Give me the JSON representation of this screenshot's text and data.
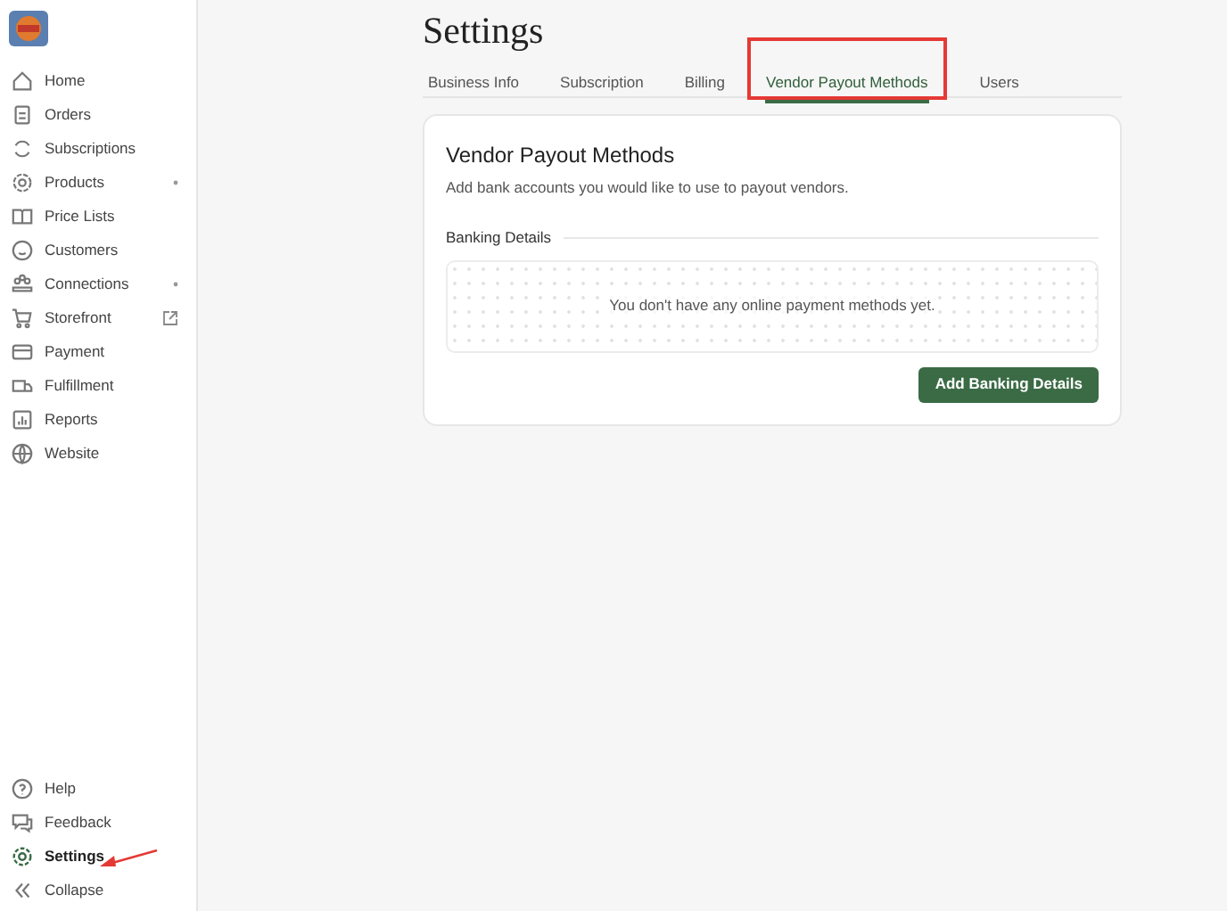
{
  "sidebar": {
    "items": [
      {
        "label": "Home",
        "kind": "plain",
        "selected": false
      },
      {
        "label": "Orders",
        "kind": "plain",
        "selected": false
      },
      {
        "label": "Subscriptions",
        "kind": "plain",
        "selected": false
      },
      {
        "label": "Products",
        "kind": "expandable",
        "selected": false
      },
      {
        "label": "Price Lists",
        "kind": "plain",
        "selected": false
      },
      {
        "label": "Customers",
        "kind": "plain",
        "selected": false
      },
      {
        "label": "Connections",
        "kind": "expandable",
        "selected": false
      },
      {
        "label": "Storefront",
        "kind": "external",
        "selected": false
      },
      {
        "label": "Payment",
        "kind": "plain",
        "selected": false
      },
      {
        "label": "Fulfillment",
        "kind": "plain",
        "selected": false
      },
      {
        "label": "Reports",
        "kind": "plain",
        "selected": false
      },
      {
        "label": "Website",
        "kind": "plain",
        "selected": false
      }
    ],
    "footer_items": [
      {
        "label": "Help",
        "selected": false
      },
      {
        "label": "Feedback",
        "selected": false
      },
      {
        "label": "Settings",
        "selected": true
      },
      {
        "label": "Collapse",
        "selected": false
      }
    ]
  },
  "page": {
    "title": "Settings",
    "tabs": [
      {
        "label": "Business Info",
        "selected": false
      },
      {
        "label": "Subscription",
        "selected": false
      },
      {
        "label": "Billing",
        "selected": false
      },
      {
        "label": "Vendor Payout Methods",
        "selected": true
      },
      {
        "label": "Users",
        "selected": false
      }
    ],
    "card": {
      "title": "Vendor Payout Methods",
      "description": "Add bank accounts you would like to use to payout vendors.",
      "section": "Banking Details",
      "empty_message": "You don't have any online payment methods yet.",
      "button": "Add Banking Details"
    }
  }
}
